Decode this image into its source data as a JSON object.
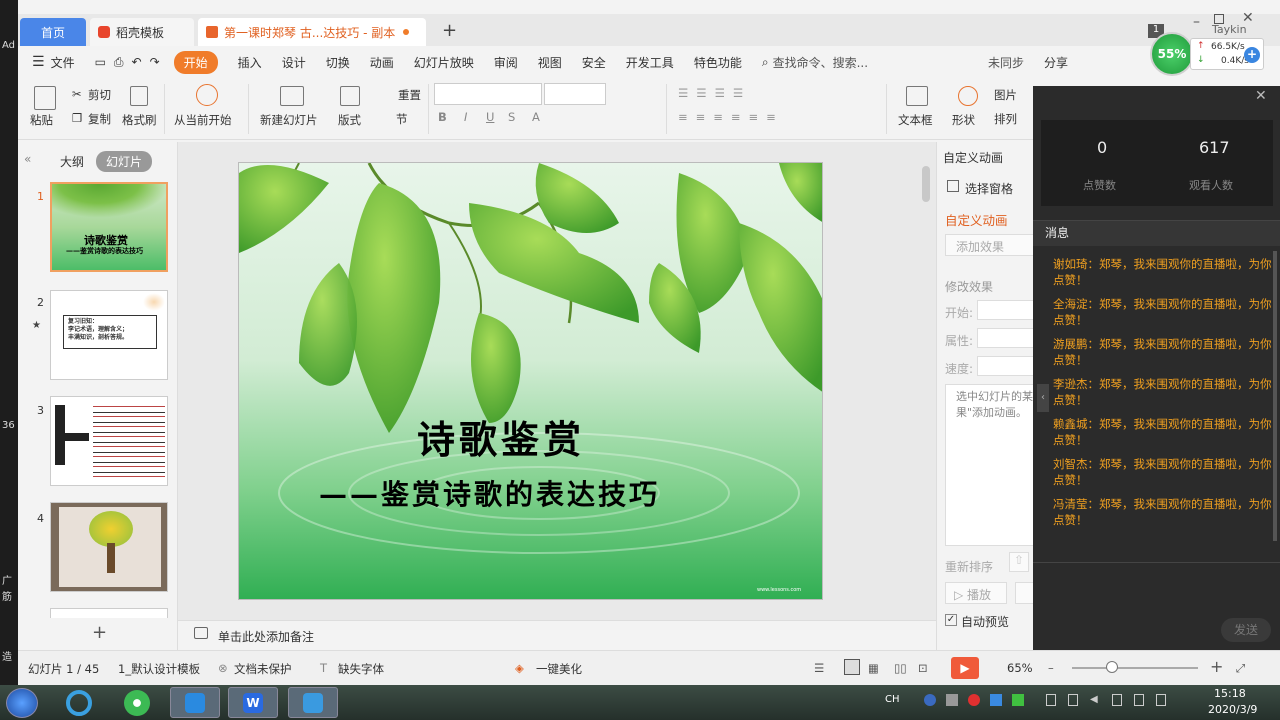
{
  "desktop": {
    "fragments": [
      "Ad",
      "36",
      "广",
      "筋",
      "造"
    ]
  },
  "tabs": {
    "home": "首页",
    "template": "稻壳模板",
    "document": "第一课时郑琴 古...达技巧 - 副本",
    "new": "+"
  },
  "window": {
    "user": "Taykin",
    "badge": "1"
  },
  "menu": {
    "file": "文件",
    "items": [
      "开始",
      "插入",
      "设计",
      "切换",
      "动画",
      "幻灯片放映",
      "审阅",
      "视图",
      "安全",
      "开发工具",
      "特色功能"
    ],
    "search": "查找命令、搜索...",
    "sync": "未同步",
    "share": "分享"
  },
  "ribbon": {
    "paste": "粘贴",
    "cut": "剪切",
    "copy": "复制",
    "format_painter": "格式刷",
    "from_current": "从当前开始",
    "new_slide": "新建幻灯片",
    "layout": "版式",
    "reset": "重置",
    "section": "节",
    "textbox": "文本框",
    "shape": "形状",
    "picture": "图片",
    "arrange": "排列"
  },
  "network": {
    "percent": "55%",
    "up": "66.5K/s",
    "down": "0.4K/s"
  },
  "thumbs": {
    "tab_outline": "大纲",
    "tab_slides": "幻灯片",
    "numbers": [
      "1",
      "2",
      "3",
      "4"
    ],
    "t1_title": "诗歌鉴赏",
    "t1_sub": "——鉴赏诗歌的表达技巧",
    "t2_line1": "复习旧知：",
    "t2_line2": "李记术语，理解含义；",
    "t2_line3": "丰满知识，剖析答规。",
    "add": "+"
  },
  "slide": {
    "title": "诗歌鉴赏",
    "subtitle": "——鉴赏诗歌的表达技巧",
    "watermark": "www.lessons.com"
  },
  "notes": {
    "placeholder": "单击此处添加备注"
  },
  "anim": {
    "header": "自定义动画",
    "select_pane": "选择窗格",
    "title": "自定义动画",
    "add_effect": "添加效果",
    "modify": "修改效果",
    "start": "开始:",
    "property": "属性:",
    "speed": "速度:",
    "hint": "选中幻灯片的某果\"添加动画。",
    "reorder": "重新排序",
    "play": "播放",
    "autopreview": "自动预览"
  },
  "live": {
    "likes": "0",
    "likes_label": "点赞数",
    "viewers": "617",
    "viewers_label": "观看人数",
    "messages_title": "消息",
    "messages": [
      "谢如琦：郑琴，我来围观你的直播啦，为你点赞！",
      "全海淀：郑琴，我来围观你的直播啦，为你点赞！",
      "游展鹏：郑琴，我来围观你的直播啦，为你点赞！",
      "李逊杰：郑琴，我来围观你的直播啦，为你点赞！",
      "赖鑫城：郑琴，我来围观你的直播啦，为你点赞！",
      "刘智杰：郑琴，我来围观你的直播啦，为你点赞！",
      "冯清莹：郑琴，我来围观你的直播啦，为你点赞！"
    ],
    "send": "发送"
  },
  "status": {
    "slide_count": "幻灯片 1 / 45",
    "template": "1_默认设计模板",
    "protect": "文档未保护",
    "font_missing": "缺失字体",
    "beautify": "一键美化",
    "zoom": "65%"
  },
  "taskbar": {
    "lang": "CH",
    "time": "15:18",
    "date": "2020/3/9"
  },
  "colors": {
    "accent": "#f07c2a",
    "home_tab": "#4a86e8",
    "live_msg": "#f0a020"
  }
}
